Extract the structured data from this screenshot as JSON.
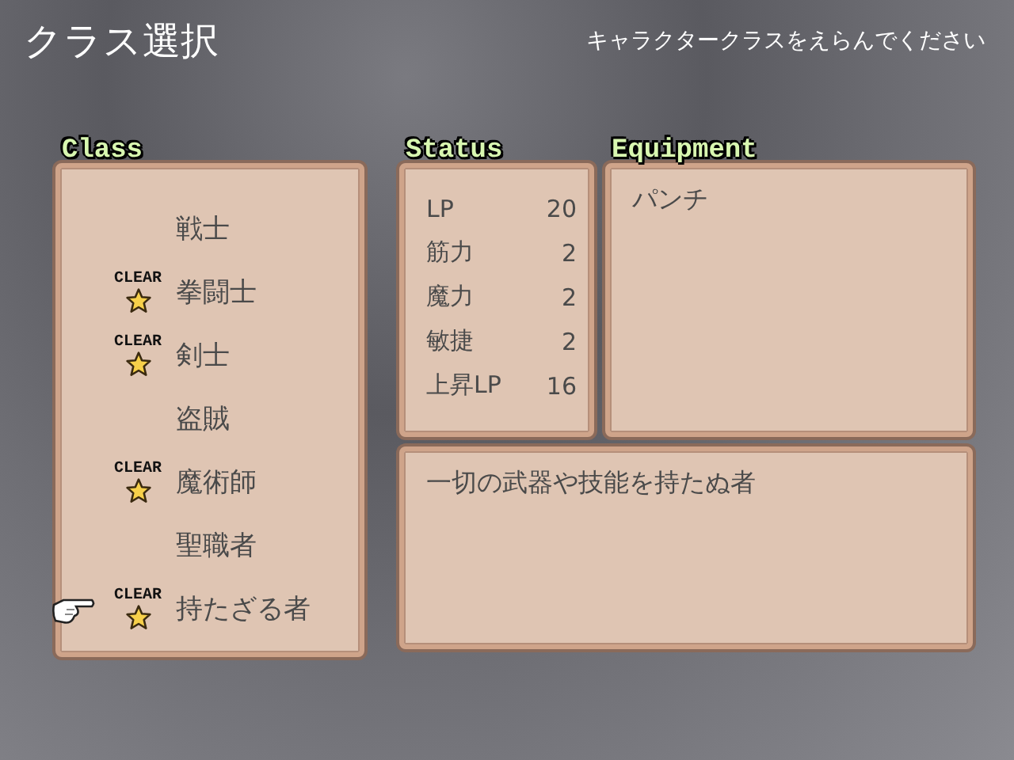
{
  "header": {
    "title": "クラス選択",
    "hint": "キャラクタークラスをえらんでください"
  },
  "class_panel": {
    "label": "Class",
    "items": [
      {
        "name": "戦士",
        "selected": false
      },
      {
        "name": "拳闘士",
        "badge": "CLEAR",
        "selected": false
      },
      {
        "name": "剣士",
        "badge": "CLEAR",
        "selected": false
      },
      {
        "name": "盗賊",
        "selected": false
      },
      {
        "name": "魔術師",
        "badge": "CLEAR",
        "selected": false
      },
      {
        "name": "聖職者",
        "selected": false
      },
      {
        "name": "持たざる者",
        "badge": "CLEAR",
        "selected": true
      }
    ]
  },
  "status_panel": {
    "label": "Status",
    "rows": [
      {
        "name": "LP",
        "value": "20"
      },
      {
        "name": "筋力",
        "value": "2"
      },
      {
        "name": "魔力",
        "value": "2"
      },
      {
        "name": "敏捷",
        "value": "2"
      },
      {
        "name": "上昇LP",
        "value": "16"
      }
    ]
  },
  "equipment_panel": {
    "label": "Equipment",
    "items": [
      "パンチ"
    ]
  },
  "description": "一切の武器や技能を持たぬ者"
}
